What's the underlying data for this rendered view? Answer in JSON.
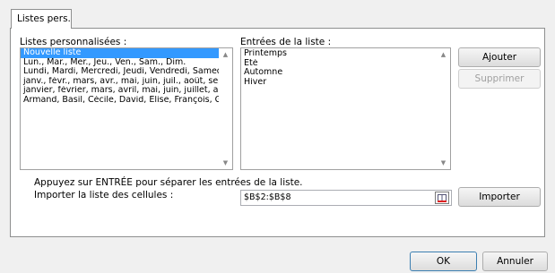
{
  "tab": {
    "label": "Listes pers."
  },
  "custom_lists": {
    "label": "Listes personnalisées :",
    "items": [
      "Nouvelle liste",
      "Lun., Mar., Mer., Jeu., Ven., Sam., Dim.",
      "Lundi, Mardi, Mercredi, Jeudi, Vendredi, Samedi, Dima",
      "janv., févr., mars, avr., mai, juin, juil., août, sept., oct",
      "janvier, février, mars, avril, mai, juin, juillet, août, sep",
      "Armand, Basil, Cécile, David, Elise, François, Georges"
    ],
    "selected_index": 0
  },
  "entries": {
    "label": "Entrées de la liste :",
    "items": [
      "Printemps",
      "Eté",
      "Automne",
      "Hiver"
    ]
  },
  "buttons": {
    "add": "Ajouter",
    "delete": "Supprimer",
    "import": "Importer",
    "ok": "OK",
    "cancel": "Annuler"
  },
  "hint": "Appuyez sur ENTRÉE pour séparer les entrées de la liste.",
  "import_label": "Importer la liste des cellules :",
  "import_range": "$B$2:$B$8"
}
